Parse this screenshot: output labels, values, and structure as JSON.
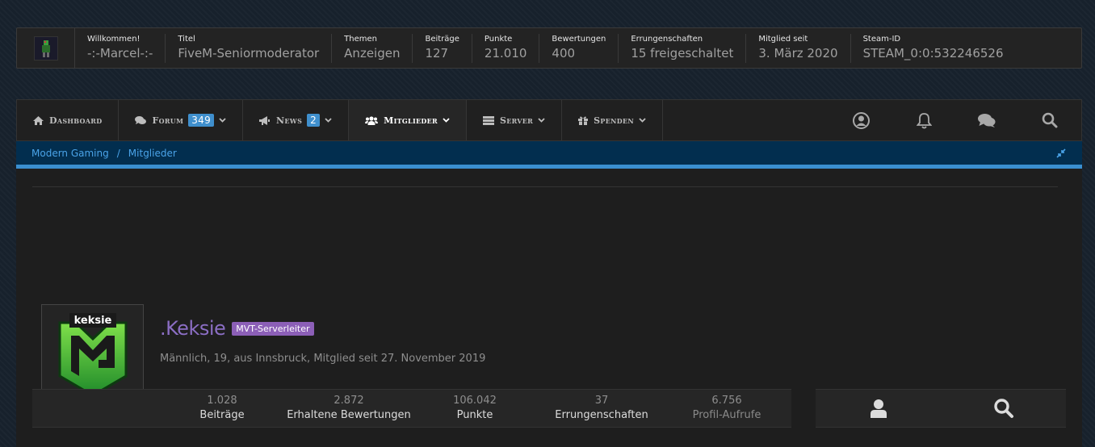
{
  "userbar": {
    "cells": [
      {
        "label": "Willkommen!",
        "value": "-:-Marcel-:-"
      },
      {
        "label": "Titel",
        "value": "FiveM-Seniormoderator"
      },
      {
        "label": "Themen",
        "value": "Anzeigen"
      },
      {
        "label": "Beiträge",
        "value": "127"
      },
      {
        "label": "Punkte",
        "value": "21.010"
      },
      {
        "label": "Bewertungen",
        "value": "400"
      },
      {
        "label": "Errungenschaften",
        "value": "15 freigeschaltet"
      },
      {
        "label": "Mitglied seit",
        "value": "3. März 2020"
      },
      {
        "label": "Steam-ID",
        "value": "STEAM_0:0:532246526"
      }
    ]
  },
  "nav": {
    "dashboard": "Dashboard",
    "forum": "Forum",
    "forum_badge": "349",
    "news": "News",
    "news_badge": "2",
    "members": "Mitglieder",
    "server": "Server",
    "donate": "Spenden",
    "icons": [
      "user-circle-icon",
      "bell-icon",
      "comments-icon",
      "search-icon"
    ]
  },
  "breadcrumb": {
    "items": [
      "Modern Gaming",
      "Mitglieder"
    ],
    "separator": "/"
  },
  "profile": {
    "name": ".Keksie",
    "rank": "MVT-Serverleiter",
    "subtitle": "Männlich, 19, aus Innsbruck, Mitglied seit 27. November 2019",
    "avatar_text": "keksie",
    "stats": [
      {
        "value": "1.028",
        "label": "Beiträge"
      },
      {
        "value": "2.872",
        "label": "Erhaltene Bewertungen"
      },
      {
        "value": "106.042",
        "label": "Punkte"
      },
      {
        "value": "37",
        "label": "Errungenschaften"
      },
      {
        "value": "6.756",
        "label": "Profil-Aufrufe"
      }
    ],
    "actions": [
      "user-icon",
      "search-icon"
    ]
  },
  "colors": {
    "accent": "#3a8fd0",
    "breadcrumb_bg": "#022e4f",
    "name": "#8b6ec4",
    "rank_badge": "#8c5fb7",
    "badge": "#3f8fcd"
  }
}
